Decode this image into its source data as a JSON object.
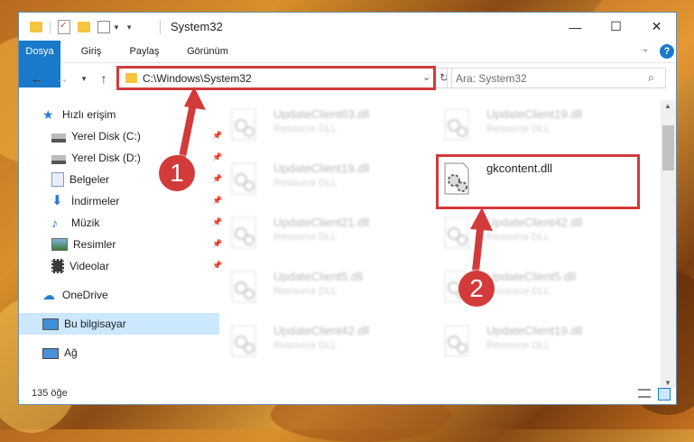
{
  "window": {
    "title": "System32",
    "controls": {
      "minimize": "—",
      "maximize": "☐",
      "close": "✕"
    }
  },
  "ribbon": {
    "tabs": [
      "Dosya",
      "Giriş",
      "Paylaş",
      "Görünüm"
    ],
    "help": "?"
  },
  "navigation": {
    "address": "C:\\Windows\\System32",
    "search_placeholder": "Ara: System32"
  },
  "sidebar": {
    "items": [
      {
        "label": "Hızlı erişim",
        "icon": "star-icon"
      },
      {
        "label": "Yerel Disk (C:)",
        "icon": "drive-icon",
        "pinned": true
      },
      {
        "label": "Yerel Disk (D:)",
        "icon": "drive-icon",
        "pinned": true
      },
      {
        "label": "Belgeler",
        "icon": "documents-icon",
        "pinned": true
      },
      {
        "label": "İndirmeler",
        "icon": "download-icon",
        "pinned": true
      },
      {
        "label": "Müzik",
        "icon": "music-icon",
        "pinned": true
      },
      {
        "label": "Resimler",
        "icon": "pictures-icon",
        "pinned": true
      },
      {
        "label": "Videolar",
        "icon": "videos-icon",
        "pinned": true
      },
      {
        "label": "OneDrive",
        "icon": "cloud-icon"
      },
      {
        "label": "Bu bilgisayar",
        "icon": "computer-icon",
        "selected": true
      },
      {
        "label": "Ağ",
        "icon": "network-icon"
      }
    ]
  },
  "files": [
    {
      "name": "UpdateClient63.dll",
      "type": "Resource DLL"
    },
    {
      "name": "UpdateClient19.dll",
      "type": "Resource DLL"
    },
    {
      "name": "UpdateClient19.dll",
      "type": "Resource DLL"
    },
    {
      "name": "gkcontent.dll",
      "type": ""
    },
    {
      "name": "UpdateClient21.dll",
      "type": "Resource DLL"
    },
    {
      "name": "UpdateClient42.dll",
      "type": "Resource DLL"
    },
    {
      "name": "UpdateClient5.dll",
      "type": "Resource DLL"
    },
    {
      "name": "UpdateClient5.dll",
      "type": "Resource DLL"
    },
    {
      "name": "UpdateClient42.dll",
      "type": "Resource DLL"
    },
    {
      "name": "UpdateClient19.dll",
      "type": "Resource DLL"
    }
  ],
  "status": {
    "count": "135 öğe"
  },
  "annotations": {
    "step1": "1",
    "step2": "2"
  },
  "colors": {
    "accent": "#1979ca",
    "highlight": "#d33a3a",
    "selected": "#cce8ff"
  }
}
